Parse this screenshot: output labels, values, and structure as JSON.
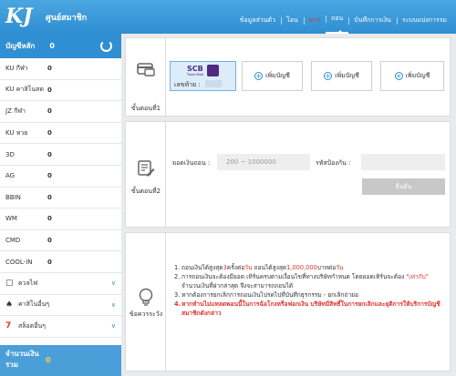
{
  "header": {
    "logo": "KJ",
    "subtitle": "ศูนย์สมาชิก",
    "nav": [
      "ข้อมูลส่วนตัว",
      "โอน",
      "ฝาก",
      "ถอน",
      "บันทึกการเงิน",
      "ระบบแบ่งการรม"
    ]
  },
  "sidebar": {
    "main_label": "บัญชีหลัก",
    "main_value": "0",
    "rows": [
      {
        "name": "KU กีฬา",
        "value": "0"
      },
      {
        "name": "KU คาสิโนสด",
        "value": "0"
      },
      {
        "name": "JZ กีฬา",
        "value": "0"
      },
      {
        "name": "KU หวย",
        "value": "0"
      },
      {
        "name": "3D",
        "value": "0"
      },
      {
        "name": "AG",
        "value": "0"
      },
      {
        "name": "BBIN",
        "value": "0"
      },
      {
        "name": "WM",
        "value": "0"
      },
      {
        "name": "CMD",
        "value": "0"
      },
      {
        "name": "COOL-IN",
        "value": "0"
      }
    ],
    "expand": [
      "ดวลไฟ",
      "คาสิโนอื่นๆ",
      "สล็อตอื่นๆ"
    ],
    "total_label": "จำนวนเงินรวม",
    "total_value": "0"
  },
  "step1": {
    "label": "ขั้นตอนที่1",
    "bank_code": "SCB",
    "bank_sub": "ไทยพาณิชย์",
    "account_label": "เลขท้าย :",
    "add_label": "เพิ่มบัญชี"
  },
  "step2": {
    "label": "ขั้นตอนที่2",
    "amount_label": "ยอดเงินถอน :",
    "amount_placeholder": "200 ~ 1000000",
    "pin_label": "รหัสป้องกัน :",
    "confirm_label": "ยืนยัน"
  },
  "notice": {
    "label": "ข้อควรระวัง",
    "items": [
      {
        "num": "1.",
        "parts": [
          {
            "t": "ถอนเงินได้สูงสุด",
            "red": false
          },
          {
            "t": "3",
            "red": true
          },
          {
            "t": "ครั้งต่อ",
            "red": false
          },
          {
            "t": "วัน",
            "red": true
          },
          {
            "t": " ถอนได้สูงสุด",
            "red": false
          },
          {
            "t": "1,000,000",
            "red": true
          },
          {
            "t": "บาทต่อ",
            "red": false
          },
          {
            "t": "วัน",
            "red": true
          }
        ]
      },
      {
        "num": "2.",
        "parts": [
          {
            "t": "การถอนเงินจะต้องมียอด เทิร์นครบตามเงื่อนไขที่ทางบริษัทกำหนด โดยยอดเทิร์นจะต้อง ",
            "red": false
          },
          {
            "t": "\"เท่ากับ\"",
            "red": true
          },
          {
            "t": " จำนวนเงินที่ฝากล่าสุด จึงจะสามารถถอนได้",
            "red": false
          }
        ]
      },
      {
        "num": "3.",
        "parts": [
          {
            "t": "หากต้องการยกเลิกการถอนเงินไปรดไปที่บันทึกธุรกรรม - ยกเลิกถ่ายอ",
            "red": false
          }
        ]
      },
      {
        "num": "4.",
        "parts": [
          {
            "t": "หากทำนไม่แทลดพอนนี้ในการฉ้อโกงหรือฟอกเงิน บริษัทมีสิทธิ์ในการยกเลิกและยุติการให้บริการบัญชีสมาชิกดังกล่าว",
            "red": true
          }
        ]
      }
    ]
  },
  "colors": {
    "primary": "#2f8fd2",
    "accent_red": "#e0332f",
    "gold": "#ffcd4a"
  }
}
